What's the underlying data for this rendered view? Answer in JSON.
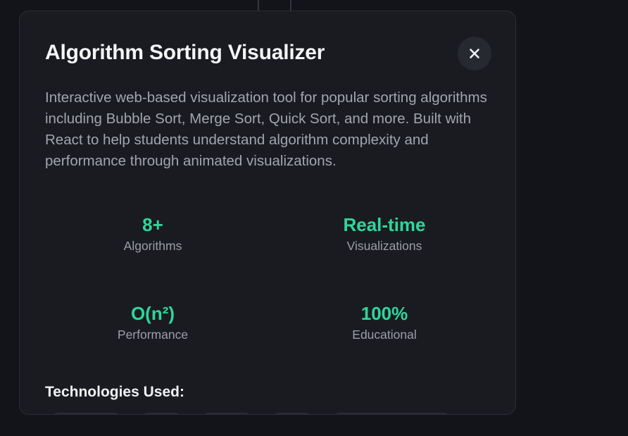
{
  "modal": {
    "title": "Algorithm Sorting Visualizer",
    "close_icon": "close-icon",
    "description": "Interactive web-based visualization tool for popular sorting algorithms including Bubble Sort, Merge Sort, Quick Sort, and more. Built with React to help students understand algorithm complexity and performance through animated visualizations."
  },
  "stats": [
    {
      "value": "8+",
      "label": "Algorithms"
    },
    {
      "value": "Real-time",
      "label": "Visualizations"
    },
    {
      "value": "O(n²)",
      "label": "Performance"
    },
    {
      "value": "100%",
      "label": "Educational"
    }
  ],
  "technologies": {
    "heading": "Technologies Used:"
  },
  "colors": {
    "accent": "#2fd69a",
    "modal_background": "#1a1b20",
    "page_background": "#131419"
  }
}
